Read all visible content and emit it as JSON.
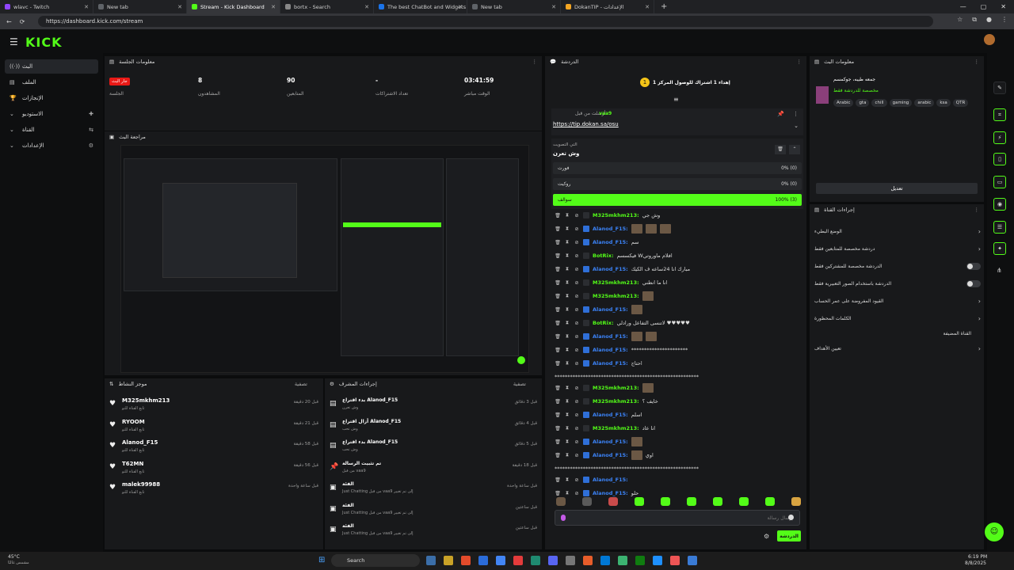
{
  "browser": {
    "tabs": [
      {
        "title": "wlavc - Twitch",
        "color": "#9146ff",
        "active": false
      },
      {
        "title": "New tab",
        "color": "#5f6368",
        "active": false
      },
      {
        "title": "Stream - Kick Dashboard",
        "color": "#53fc18",
        "active": true
      },
      {
        "title": "bortx - Search",
        "color": "#888888",
        "active": false
      },
      {
        "title": "The best ChatBot and Widgets fo",
        "color": "#1a73e8",
        "active": false
      },
      {
        "title": "New tab",
        "color": "#5f6368",
        "active": false
      },
      {
        "title": "DokanTIP - الإعدادات",
        "color": "#f5a623",
        "active": false
      }
    ],
    "url": "https://dashboard.kick.com/stream"
  },
  "app": {
    "logo": "KICK"
  },
  "sidebar": {
    "items": [
      {
        "label": "البث",
        "icon": "broadcast-icon",
        "glyph": "((·))",
        "right": ""
      },
      {
        "label": "الملف",
        "icon": "file-icon",
        "glyph": "▤",
        "right": ""
      },
      {
        "label": "الإنجازات",
        "icon": "trophy-icon",
        "glyph": "🏆",
        "right": ""
      },
      {
        "label": "الاستوديو",
        "icon": "chevron-down-icon",
        "glyph": "⌄",
        "right": "✚"
      },
      {
        "label": "القناة",
        "icon": "chevron-down-icon",
        "glyph": "⌄",
        "right": "⇆"
      },
      {
        "label": "الإعدادات",
        "icon": "chevron-down-icon",
        "glyph": "⌄",
        "right": "⚙"
      }
    ]
  },
  "session": {
    "title": "معلومات الجلسة",
    "stats": [
      {
        "value": "جار البث",
        "label": "الجلسة"
      },
      {
        "value": "8",
        "label": "المشاهدون"
      },
      {
        "value": "90",
        "label": "المتابعين"
      },
      {
        "value": "-",
        "label": "تعداد الاشتراكات"
      },
      {
        "value": "03:41:59",
        "label": "الوقت مباشر"
      }
    ]
  },
  "preview": {
    "title": "مراجعة البث"
  },
  "activity": {
    "title": "موجز النشاط",
    "filter": "تصفية",
    "items": [
      {
        "name": "M325mkhm213",
        "sub": "تابع القناة للتو",
        "time": "قبل 20 دقيقة"
      },
      {
        "name": "RYOOM",
        "sub": "تابع القناة للتو",
        "time": "قبل 21 دقيقة"
      },
      {
        "name": "Alanod_F15",
        "sub": "تابع القناة للتو",
        "time": "قبل 58 دقيقة"
      },
      {
        "name": "T62MN",
        "sub": "تابع القناة للتو",
        "time": "قبل 56 دقيقة"
      },
      {
        "name": "malek99988",
        "sub": "تابع القناة للتو",
        "time": "قبل ساعة واحدة"
      }
    ]
  },
  "modactions": {
    "title": "إجراءات المشرف",
    "filter": "تصفية",
    "items": [
      {
        "title": "بدء اقتراع Alanod_F15",
        "sub": "وش تعرن",
        "time": "قبل 3 دقائق",
        "icon": "poll-icon"
      },
      {
        "title": "أزال اقتراع Alanod_F15",
        "sub": "وش تحب",
        "time": "قبل 4 دقائق",
        "icon": "poll-icon"
      },
      {
        "title": "بدء اقتراع Alanod_F15",
        "sub": "وش تحب",
        "time": "قبل 5 دقائق",
        "icon": "poll-icon"
      },
      {
        "title": "تم تثبيت الرسالة",
        "sub": "من قبل vaa9",
        "time": "قبل 18 دقيقة",
        "icon": "pin-icon"
      },
      {
        "title": "الفئة",
        "sub": "Just Chatting من قبل vaa9 إلى تم تغيير",
        "time": "قبل ساعة واحدة",
        "icon": "category-icon"
      },
      {
        "title": "الفئة",
        "sub": "Just Chatting من قبل vaa9 إلى تم تغيير",
        "time": "قبل ساعتين",
        "icon": "category-icon"
      },
      {
        "title": "الفئة",
        "sub": "Just Chatting من قبل vaa9 إلى تم تغيير",
        "time": "قبل ساعتين",
        "icon": "category-icon"
      }
    ]
  },
  "chat": {
    "title": "الدردشة",
    "goal": "إهداء 1 اشتراك للوصول المركز 1",
    "pinned": {
      "by": "vaa9",
      "label": "أرسلت من قبل",
      "link": "https://tip.dokan.sa/osu"
    },
    "poll": {
      "label": "التي التصويت",
      "question": "وش تعرن",
      "options": [
        {
          "label": "فورت",
          "pct": "0% (0)",
          "winner": false
        },
        {
          "label": "روكيت",
          "pct": "0% (0)",
          "winner": false
        },
        {
          "label": "سوالف",
          "pct": "100% (3)",
          "winner": true
        }
      ]
    },
    "messages": [
      {
        "user": "M325mkhm213",
        "color": "#53fc18",
        "text": "وش جي",
        "emotes": 0
      },
      {
        "user": "Alanod_F15",
        "color": "#3b82f6",
        "text": "",
        "emotes": 3
      },
      {
        "user": "Alanod_F15",
        "color": "#3b82f6",
        "text": "سم",
        "emotes": 0
      },
      {
        "user": "BotRix",
        "color": "#53fc18",
        "text": "فيكسسم Wافلام ماوروتي",
        "emotes": 0
      },
      {
        "user": "Alanod_F15",
        "color": "#3b82f6",
        "text": "مبارك انا 24ساعه ف الكيك",
        "emotes": 0
      },
      {
        "user": "M325mkhm213",
        "color": "#53fc18",
        "text": "انا ما انطني",
        "emotes": 0
      },
      {
        "user": "M325mkhm213",
        "color": "#53fc18",
        "text": "",
        "emotes": 1
      },
      {
        "user": "Alanod_F15",
        "color": "#3b82f6",
        "text": "",
        "emotes": 1
      },
      {
        "user": "BotRix",
        "color": "#53fc18",
        "text": "لاتنسى التفاعل ورادلي ♥♥♥♥♥",
        "emotes": 0
      },
      {
        "user": "Alanod_F15",
        "color": "#3b82f6",
        "text": "",
        "emotes": 2
      },
      {
        "user": "Alanod_F15",
        "color": "#3b82f6",
        "text": "**********************",
        "emotes": 0
      },
      {
        "user": "Alanod_F15",
        "color": "#3b82f6",
        "text": "احتاج",
        "emotes": 0
      },
      {
        "user": "M325mkhm213",
        "color": "#53fc18",
        "text": "",
        "emotes": 1
      },
      {
        "user": "M325mkhm213",
        "color": "#53fc18",
        "text": "خايف ؟",
        "emotes": 0
      },
      {
        "user": "Alanod_F15",
        "color": "#3b82f6",
        "text": "اسلم",
        "emotes": 0
      },
      {
        "user": "M325mkhm213",
        "color": "#53fc18",
        "text": "انا عاد",
        "emotes": 0
      },
      {
        "user": "Alanod_F15",
        "color": "#3b82f6",
        "text": "",
        "emotes": 1
      },
      {
        "user": "Alanod_F15",
        "color": "#3b82f6",
        "text": "اوي",
        "emotes": 1
      },
      {
        "user": "Alanod_F15",
        "color": "#3b82f6",
        "text": "",
        "emotes": 0
      },
      {
        "user": "Alanod_F15",
        "color": "#3b82f6",
        "text": "حلو",
        "emotes": 0
      }
    ],
    "input_placeholder": "إرسال رسالة",
    "send_label": "الدردشة"
  },
  "streaminfo": {
    "title": "معلومات البث",
    "stream_title": "جمعه طيبه، جوكمسم",
    "category": "مخصصة للدردشة فقط",
    "tags": [
      "Arabic",
      "gta",
      "chill",
      "gaming",
      "arabic",
      "ksa",
      "QTR"
    ],
    "edit_label": "تعديل"
  },
  "channelactions": {
    "title": "إجراءات القناة",
    "items": [
      {
        "label": "الوضع البطيء",
        "control": "chevron"
      },
      {
        "label": "دردشة مخصصة للمتابعين فقط",
        "control": "chevron"
      },
      {
        "label": "الدردشة مخصصة للمشتركين فقط",
        "control": "toggle"
      },
      {
        "label": "الدردشة باستخدام الصور التعبيرية فقط",
        "control": "toggle"
      },
      {
        "label": "القيود المفروضة على عمر الحساب",
        "control": "chevron"
      },
      {
        "label": "الكلمات المحظورة",
        "control": "chevron"
      },
      {
        "label": "القناة المضيفة",
        "control": "none"
      },
      {
        "label": "تعيين الأهداف",
        "control": "chevron"
      }
    ]
  },
  "taskbar": {
    "weather": "45°C",
    "weather_sub": "مشمس غالبًا",
    "search": "Search",
    "time": "6:19 PM",
    "date": "8/8/2025"
  }
}
